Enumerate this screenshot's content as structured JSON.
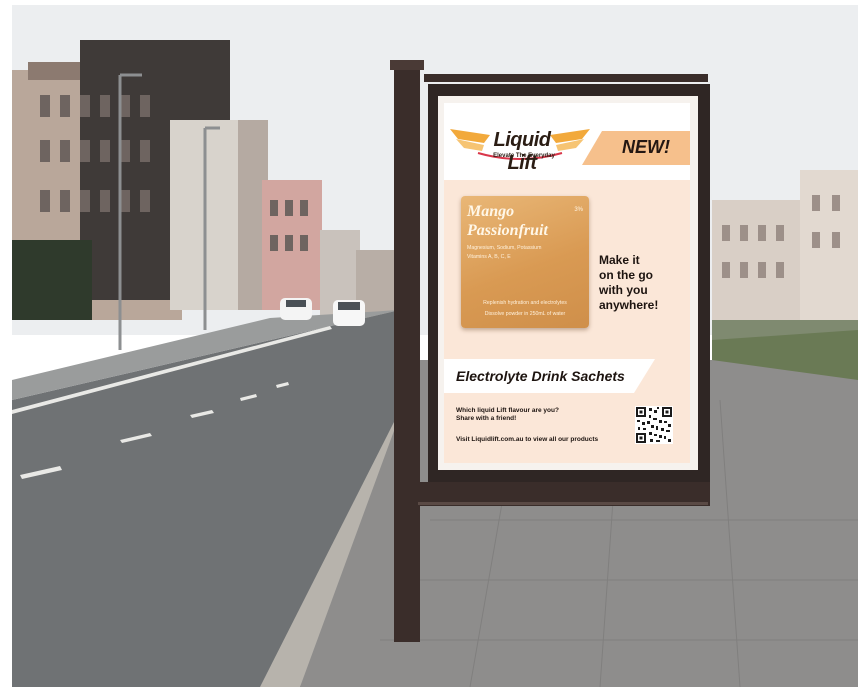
{
  "poster": {
    "brand": "Liquid Lift",
    "tagline": "Elevate The Everyday",
    "badge": "NEW!",
    "sachet": {
      "title_line1": "Mango",
      "title_line2": "Passionfruit",
      "size": "3%",
      "ingredients_line1": "Magnesium, Sodium, Potassium",
      "ingredients_line2": "Vitamins A, B, C, E",
      "footer_line1": "Replenish hydration and electrolytes",
      "footer_line2": "Dissolve powder in 250mL of water"
    },
    "slogan_line1": "Make it",
    "slogan_line2": "on the go",
    "slogan_line3": "with you",
    "slogan_line4": "anywhere!",
    "banner": "Electrolyte Drink Sachets",
    "question_line1": "Which liquid Lift flavour are you?",
    "question_line2": "Share with a friend!",
    "visit": "Visit Liquidlift.com.au to view all our products"
  },
  "colors": {
    "sky": "#e9ecef",
    "road": "#74777a",
    "frame": "#3a2d2a",
    "poster_bg": "#fbe7d8",
    "accent": "#f3b878"
  }
}
